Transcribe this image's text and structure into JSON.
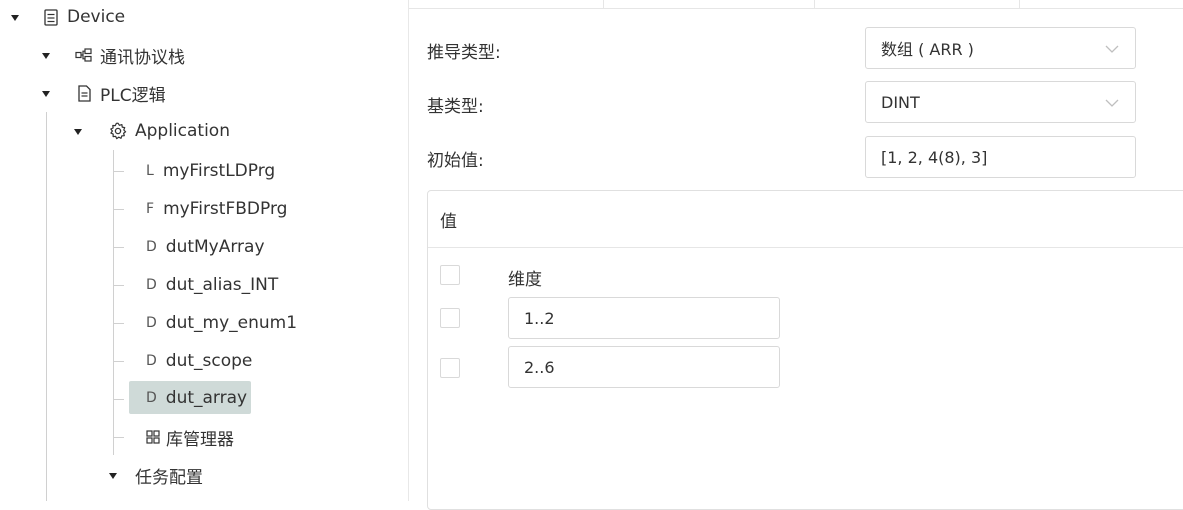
{
  "tree": {
    "device": {
      "label": "Device",
      "icon": "device-icon"
    },
    "protocol_stack": {
      "label": "通讯协议栈",
      "icon": "network-icon"
    },
    "plc_logic": {
      "label": "PLC逻辑",
      "icon": "file-icon"
    },
    "application": {
      "label": "Application",
      "icon": "gear-icon"
    },
    "items": [
      {
        "prefix": "L",
        "label": "myFirstLDPrg"
      },
      {
        "prefix": "F",
        "label": "myFirstFBDPrg"
      },
      {
        "prefix": "D",
        "label": "dutMyArray"
      },
      {
        "prefix": "D",
        "label": "dut_alias_INT"
      },
      {
        "prefix": "D",
        "label": "dut_my_enum1"
      },
      {
        "prefix": "D",
        "label": "dut_scope"
      },
      {
        "prefix": "D",
        "label": "dut_array",
        "selected": true
      }
    ],
    "library_manager": {
      "label": "库管理器",
      "icon": "grid-icon"
    },
    "task_config": {
      "label": "任务配置"
    },
    "selected_color": "#cfdad8"
  },
  "form": {
    "derived_type": {
      "label": "推导类型:",
      "value": "数组 ( ARR )"
    },
    "base_type": {
      "label": "基类型:",
      "value": "DINT"
    },
    "initial_value": {
      "label": "初始值:",
      "value": "[1, 2, 4(8), 3]"
    }
  },
  "values_card": {
    "title": "值",
    "dimension_header": "维度",
    "dimensions": [
      "1..2",
      "2..6"
    ]
  }
}
